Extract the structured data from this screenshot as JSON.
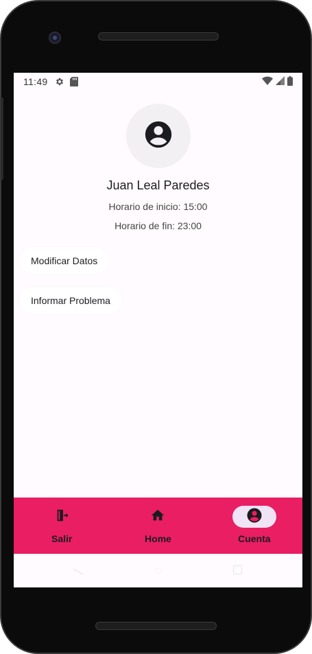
{
  "status_bar": {
    "time": "11:49",
    "icons": [
      "gear-icon",
      "sd-card-icon",
      "wifi-icon",
      "signal-icon",
      "battery-icon"
    ]
  },
  "profile": {
    "avatar_icon": "account-circle-icon",
    "name": "Juan Leal Paredes",
    "start_time": "Horario de inicio: 15:00",
    "end_time": "Horario de fin: 23:00"
  },
  "actions": {
    "modify_label": "Modificar Datos",
    "report_label": "Informar Problema"
  },
  "bottom_nav": {
    "items": [
      {
        "label": "Salir",
        "icon": "logout-icon",
        "active": false
      },
      {
        "label": "Home",
        "icon": "home-icon",
        "active": false
      },
      {
        "label": "Cuenta",
        "icon": "account-circle-icon",
        "active": true
      }
    ]
  },
  "colors": {
    "accent": "#e91e63",
    "active_pill": "#efe3f5",
    "background": "#fffbfe"
  }
}
